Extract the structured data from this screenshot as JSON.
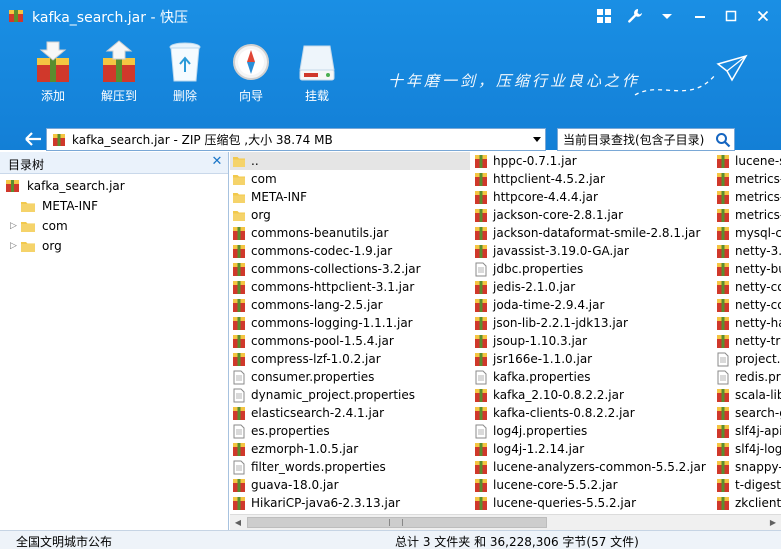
{
  "window": {
    "title": "kafka_search.jar - 快压"
  },
  "toolbar": {
    "buttons": [
      {
        "label": "添加",
        "icon": "add-archive-icon"
      },
      {
        "label": "解压到",
        "icon": "extract-icon"
      },
      {
        "label": "删除",
        "icon": "recycle-bin-icon"
      },
      {
        "label": "向导",
        "icon": "compass-icon"
      },
      {
        "label": "挂载",
        "icon": "mount-drive-icon"
      }
    ]
  },
  "slogan": "十年磨一剑，压缩行业良心之作",
  "address": {
    "text": "kafka_search.jar - ZIP 压缩包 ,大小 38.74 MB"
  },
  "search": {
    "placeholder": "当前目录查找(包含子目录)"
  },
  "tree": {
    "title": "目录树",
    "root": "kafka_search.jar",
    "children": [
      {
        "label": "META-INF",
        "expandable": false
      },
      {
        "label": "com",
        "expandable": true
      },
      {
        "label": "org",
        "expandable": true
      }
    ]
  },
  "files": {
    "columns": [
      [
        {
          "name": "..",
          "type": "folder"
        },
        {
          "name": "com",
          "type": "folder"
        },
        {
          "name": "META-INF",
          "type": "folder"
        },
        {
          "name": "org",
          "type": "folder"
        },
        {
          "name": "commons-beanutils.jar",
          "type": "jar"
        },
        {
          "name": "commons-codec-1.9.jar",
          "type": "jar"
        },
        {
          "name": "commons-collections-3.2.jar",
          "type": "jar"
        },
        {
          "name": "commons-httpclient-3.1.jar",
          "type": "jar"
        },
        {
          "name": "commons-lang-2.5.jar",
          "type": "jar"
        },
        {
          "name": "commons-logging-1.1.1.jar",
          "type": "jar"
        },
        {
          "name": "commons-pool-1.5.4.jar",
          "type": "jar"
        },
        {
          "name": "compress-lzf-1.0.2.jar",
          "type": "jar"
        },
        {
          "name": "consumer.properties",
          "type": "doc"
        },
        {
          "name": "dynamic_project.properties",
          "type": "doc"
        },
        {
          "name": "elasticsearch-2.4.1.jar",
          "type": "jar"
        },
        {
          "name": "es.properties",
          "type": "doc"
        },
        {
          "name": "ezmorph-1.0.5.jar",
          "type": "jar"
        },
        {
          "name": "filter_words.properties",
          "type": "doc"
        },
        {
          "name": "guava-18.0.jar",
          "type": "jar"
        },
        {
          "name": "HikariCP-java6-2.3.13.jar",
          "type": "jar"
        }
      ],
      [
        {
          "name": "hppc-0.7.1.jar",
          "type": "jar"
        },
        {
          "name": "httpclient-4.5.2.jar",
          "type": "jar"
        },
        {
          "name": "httpcore-4.4.4.jar",
          "type": "jar"
        },
        {
          "name": "jackson-core-2.8.1.jar",
          "type": "jar"
        },
        {
          "name": "jackson-dataformat-smile-2.8.1.jar",
          "type": "jar"
        },
        {
          "name": "javassist-3.19.0-GA.jar",
          "type": "jar"
        },
        {
          "name": "jdbc.properties",
          "type": "doc"
        },
        {
          "name": "jedis-2.1.0.jar",
          "type": "jar"
        },
        {
          "name": "joda-time-2.9.4.jar",
          "type": "jar"
        },
        {
          "name": "json-lib-2.2.1-jdk13.jar",
          "type": "jar"
        },
        {
          "name": "jsoup-1.10.3.jar",
          "type": "jar"
        },
        {
          "name": "jsr166e-1.1.0.jar",
          "type": "jar"
        },
        {
          "name": "kafka.properties",
          "type": "doc"
        },
        {
          "name": "kafka_2.10-0.8.2.2.jar",
          "type": "jar"
        },
        {
          "name": "kafka-clients-0.8.2.2.jar",
          "type": "jar"
        },
        {
          "name": "log4j.properties",
          "type": "doc"
        },
        {
          "name": "log4j-1.2.14.jar",
          "type": "jar"
        },
        {
          "name": "lucene-analyzers-common-5.5.2.jar",
          "type": "jar"
        },
        {
          "name": "lucene-core-5.5.2.jar",
          "type": "jar"
        },
        {
          "name": "lucene-queries-5.5.2.jar",
          "type": "jar"
        }
      ],
      [
        {
          "name": "lucene-s",
          "type": "jar"
        },
        {
          "name": "metrics-",
          "type": "jar"
        },
        {
          "name": "metrics-",
          "type": "jar"
        },
        {
          "name": "metrics-",
          "type": "jar"
        },
        {
          "name": "mysql-c",
          "type": "jar"
        },
        {
          "name": "netty-3.",
          "type": "jar"
        },
        {
          "name": "netty-bu",
          "type": "jar"
        },
        {
          "name": "netty-co",
          "type": "jar"
        },
        {
          "name": "netty-co",
          "type": "jar"
        },
        {
          "name": "netty-ha",
          "type": "jar"
        },
        {
          "name": "netty-tra",
          "type": "jar"
        },
        {
          "name": "project.p",
          "type": "doc"
        },
        {
          "name": "redis.pr",
          "type": "doc"
        },
        {
          "name": "scala-lib",
          "type": "jar"
        },
        {
          "name": "search-g",
          "type": "jar"
        },
        {
          "name": "slf4j-api",
          "type": "jar"
        },
        {
          "name": "slf4j-log",
          "type": "jar"
        },
        {
          "name": "snappy-",
          "type": "jar"
        },
        {
          "name": "t-digest",
          "type": "jar"
        },
        {
          "name": "zkclient-",
          "type": "jar"
        }
      ]
    ]
  },
  "status": {
    "left": "全国文明城市公布",
    "right": "总计 3 文件夹 和  36,228,306 字节(57 文件)"
  },
  "colors": {
    "accent": "#1a8fe4",
    "selection": "#e5e5e5",
    "folder": "#f2c94c",
    "jar_red": "#d0382b"
  }
}
